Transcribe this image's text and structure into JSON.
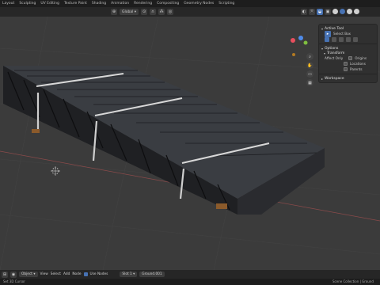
{
  "workspace_tabs": [
    "Layout",
    "Sculpting",
    "UV Editing",
    "Texture Paint",
    "Shading",
    "Animation",
    "Rendering",
    "Compositing",
    "Geometry Nodes",
    "Scripting"
  ],
  "viewport_header": {
    "orientation": "Global",
    "orientation_icon": "globe-icon",
    "snap_icon": "magnet-icon",
    "proportional_icon": "proportional-edit-icon"
  },
  "options_tab": "Options",
  "sidebar": {
    "active_tool": {
      "header": "Active Tool",
      "tool_name": "Select Box"
    },
    "options": {
      "header": "Options",
      "transform_header": "Transform",
      "affect_only_label": "Affect Only",
      "checkboxes": [
        "Origins",
        "Locations",
        "Parents"
      ]
    },
    "workspace": {
      "header": "Workspace"
    }
  },
  "bottom_bar": {
    "mode": "Object",
    "menus": [
      "View",
      "Select",
      "Add",
      "Node"
    ],
    "use_nodes": "Use Nodes",
    "slot": "Slot 1",
    "material": "Ground.001"
  },
  "status_bar": {
    "left": "Set 3D Cursor",
    "right": "Scene Collection | Ground"
  },
  "colors": {
    "accent": "#4772b3",
    "axis_x": "#e84f5e",
    "axis_y": "#7fbf3f",
    "axis_z": "#4f8be8",
    "viewport_bg": "#3b3b3b"
  }
}
